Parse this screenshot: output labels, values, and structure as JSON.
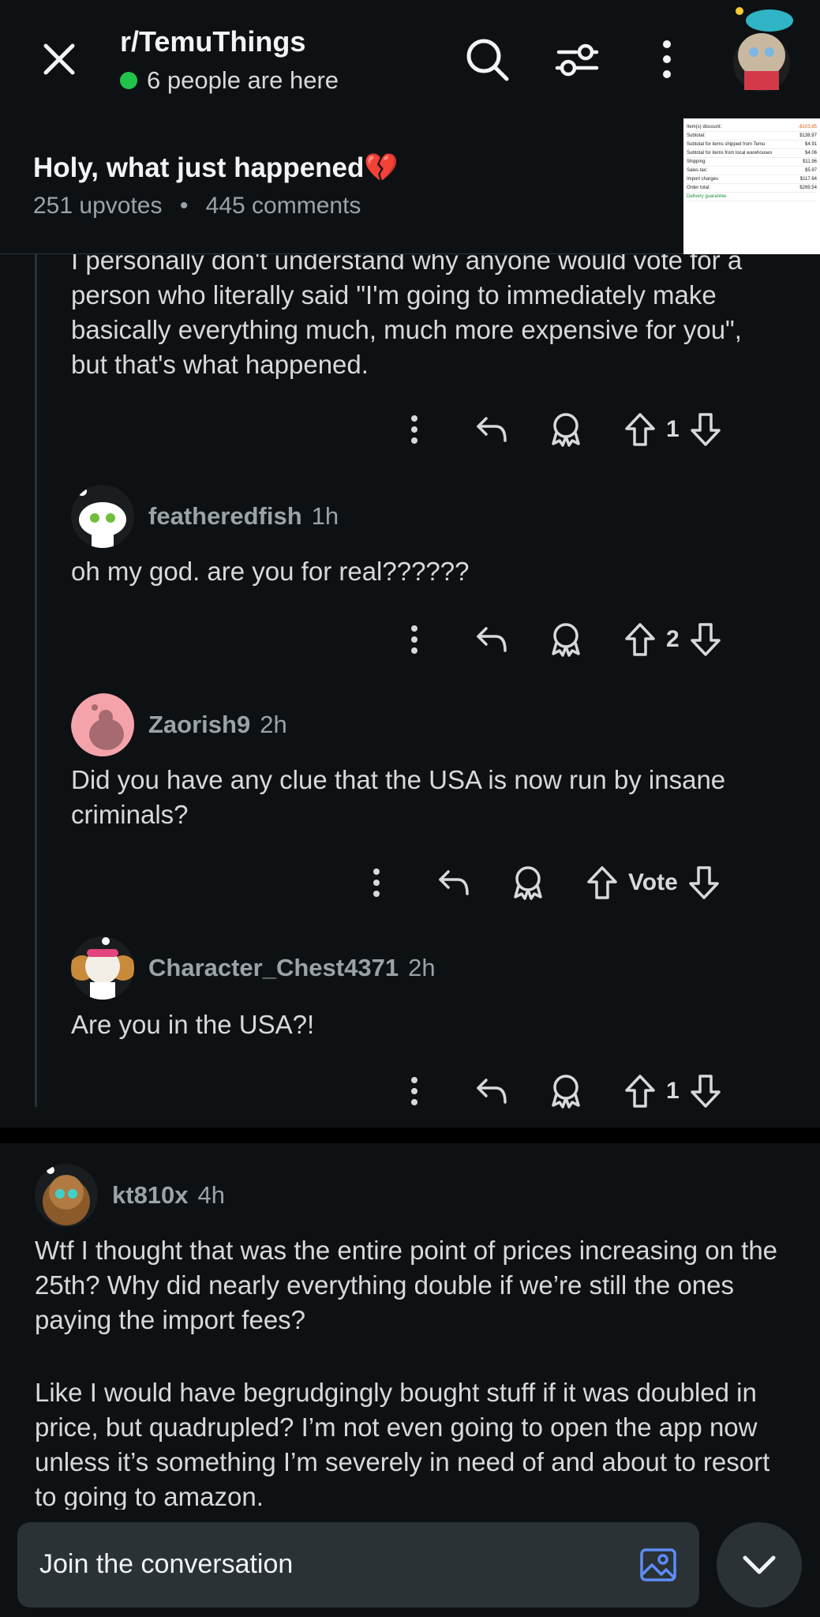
{
  "header": {
    "subreddit": "r/TemuThings",
    "presence": "6 people are here",
    "post_title": "Holy, what just happened",
    "post_title_emoji": "💔",
    "upvotes": "251 upvotes",
    "separator": "•",
    "comments": "445 comments"
  },
  "thumbnail": {
    "rows": [
      {
        "label": "Item(s) discount:",
        "value": "-$103.85"
      },
      {
        "label": "Subtotal:",
        "value": "$138.97"
      },
      {
        "label": "Subtotal for items shipped from Temu",
        "value": "$4.91"
      },
      {
        "label": "Subtotal for items from local warehouses",
        "value": "$4.06"
      },
      {
        "label": "Shipping:",
        "value": "$11.96"
      },
      {
        "label": "Sales tax:",
        "value": "$5.97"
      },
      {
        "label": "Import charges",
        "value": "$117.64"
      },
      {
        "label": "Order total:",
        "value": "$269.54"
      },
      {
        "label": "Delivery guarantee",
        "value": ""
      }
    ]
  },
  "comments": [
    {
      "text": "I personally don't understand why anyone would vote for a person who literally said \"I'm going to immediately make basically everything much, much more expensive for you\", but that's what happened.",
      "votes": "1"
    },
    {
      "author": "featheredfish",
      "time": "1h",
      "text": "oh my god. are you for real??????",
      "votes": "2"
    },
    {
      "author": "Zaorish9",
      "time": "2h",
      "text": "Did you have any clue that the USA is now run by insane criminals?",
      "votes": "Vote"
    },
    {
      "author": "Character_Chest4371",
      "time": "2h",
      "text": "Are you in the USA?!",
      "votes": "1"
    },
    {
      "author": "kt810x",
      "time": "4h",
      "text": "Wtf I thought that was the entire point of prices increasing on the 25th? Why did nearly everything double if we’re still the ones paying the import fees?",
      "text2": "Like I would have begrudgingly bought stuff if it was doubled in price, but quadrupled? I’m not even going to open the app now unless it’s something I’m severely in need of and about to resort to going to amazon."
    }
  ],
  "composer": {
    "placeholder": "Join the conversation"
  },
  "colors": {
    "background": "#0e1113",
    "online": "#21c44a",
    "composer": "#2a3236"
  }
}
